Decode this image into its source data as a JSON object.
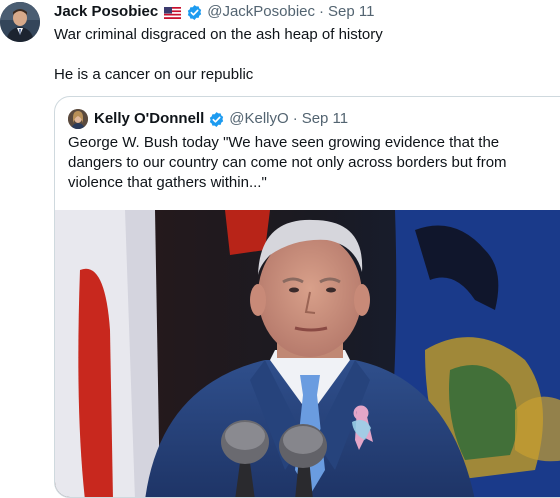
{
  "tweet": {
    "author_name": "Jack Posobiec",
    "author_handle": "@JackPosobiec",
    "separator": "·",
    "date": "Sep 11",
    "text": "War criminal disgraced on the ash heap of history\n\nHe is a cancer on our republic",
    "icons": [
      "avatar",
      "us-flag-icon",
      "verified-badge-icon"
    ]
  },
  "quote": {
    "author_name": "Kelly O'Donnell",
    "author_handle": "@KellyO",
    "separator": "·",
    "date": "Sep 11",
    "text": "George W. Bush today \"We have seen growing evidence that the dangers to our country can come not only across borders but from violence that gathers within...\"",
    "icons": [
      "avatar",
      "verified-badge-icon"
    ]
  },
  "colors": {
    "text_primary": "#0f1419",
    "text_secondary": "#536471",
    "verified_blue": "#1d9bf0",
    "card_border": "#cfd9de"
  }
}
